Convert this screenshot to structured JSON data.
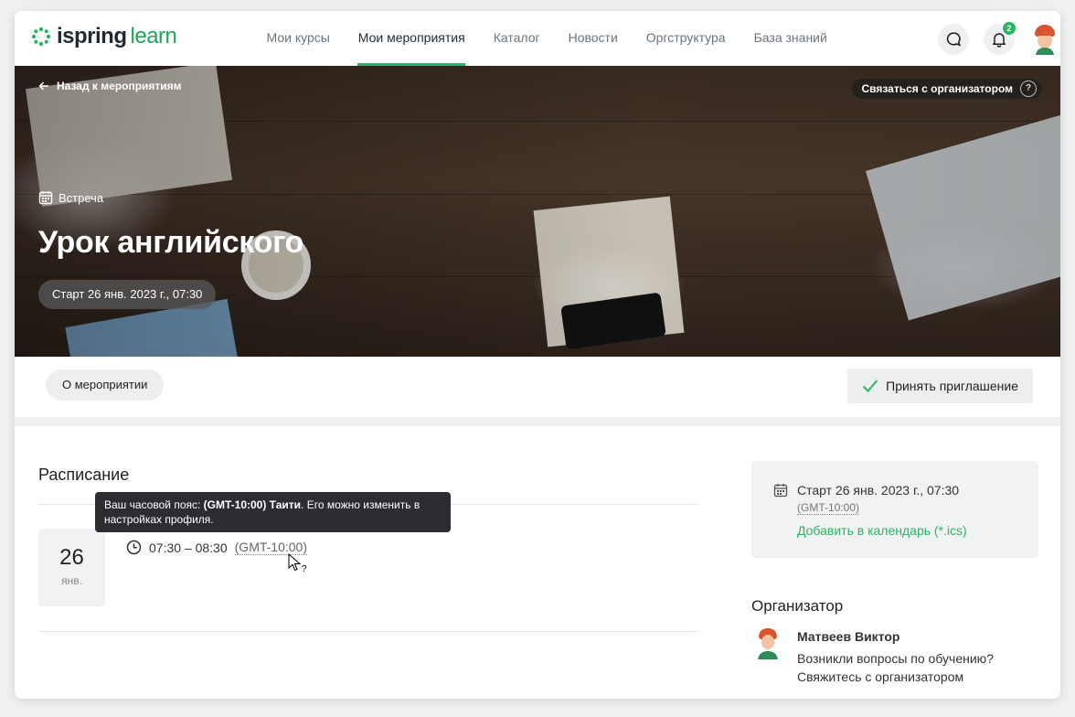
{
  "brand": {
    "word1": "ispring",
    "word2": "learn",
    "accent": "#2bb463"
  },
  "nav": {
    "items": [
      {
        "label": "Мои курсы"
      },
      {
        "label": "Мои мероприятия"
      },
      {
        "label": "Каталог"
      },
      {
        "label": "Новости"
      },
      {
        "label": "Оргструктура"
      },
      {
        "label": "База знаний"
      }
    ],
    "active_index": 1
  },
  "header": {
    "notifications_count": "2"
  },
  "hero": {
    "back_label": "Назад к мероприятиям",
    "contact_label": "Связаться с организатором",
    "contact_help": "?",
    "event_type": "Встреча",
    "title": "Урок английского",
    "start_chip": "Старт 26 янв. 2023 г., 07:30"
  },
  "tabs": {
    "about_label": "О мероприятии",
    "accept_label": "Принять приглашение"
  },
  "schedule": {
    "title": "Расписание",
    "tooltip_prefix": "Ваш часовой пояс: ",
    "tooltip_bold": "(GMT-10:00) Таити",
    "tooltip_suffix": ". Его можно изменить в настройках профиля.",
    "day": "26",
    "month": "янв.",
    "time_range": "07:30 – 08:30",
    "timezone": "(GMT-10:00)"
  },
  "info_card": {
    "start_text": "Старт 26 янв. 2023 г., 07:30",
    "timezone": "(GMT-10:00)",
    "calendar_link": "Добавить в календарь (*.ics)"
  },
  "organizer": {
    "title": "Организатор",
    "name": "Матвеев Виктор",
    "message": "Возникли вопросы по обучению? Свяжитесь с организатором"
  }
}
